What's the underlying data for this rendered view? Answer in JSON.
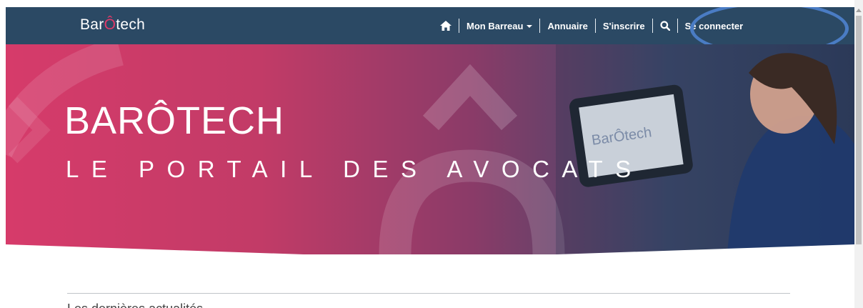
{
  "logo": {
    "part1": "Bar",
    "accent": "Ô",
    "part2": "tech"
  },
  "nav": {
    "home_icon": "home-icon",
    "mon_barreau": "Mon Barreau",
    "annuaire": "Annuaire",
    "sinscrire": "S'inscrire",
    "search_icon": "search-icon",
    "se_connecter": "Se connecter"
  },
  "hero": {
    "title": "BARÔTECH",
    "subtitle": "LE PORTAIL DES AVOCATS",
    "tablet_logo": "BarÔtech"
  },
  "section": {
    "heading_partial": "Les dernières actualités"
  },
  "colors": {
    "navbar": "#2b4964",
    "accent": "#e13a69",
    "highlight": "#4a7cc4"
  }
}
